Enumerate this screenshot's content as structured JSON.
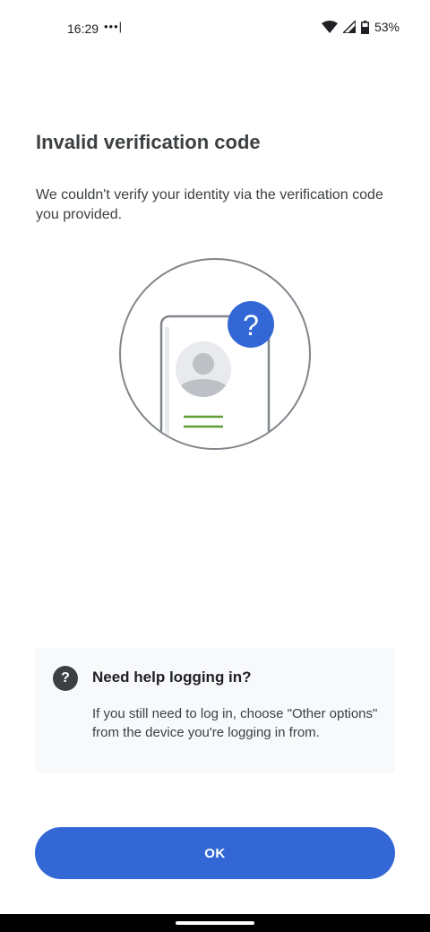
{
  "status_bar": {
    "time": "16:29",
    "dots": "•••|",
    "battery": "53%"
  },
  "page": {
    "title": "Invalid verification code",
    "subtitle": "We couldn't verify your identity via the verification code you provided."
  },
  "illustration": {
    "badge_glyph": "?",
    "icons": [
      "phone-icon",
      "avatar-icon",
      "question-badge-icon"
    ],
    "colors": {
      "badge": "#3367d6",
      "lines": "#5e9d37",
      "outline": "#80868b"
    }
  },
  "help": {
    "icon_glyph": "?",
    "title": "Need help logging in?",
    "body": "If you still need to log in, choose \"Other options\" from the device you're logging in from."
  },
  "actions": {
    "ok_label": "OK"
  },
  "colors": {
    "accent": "#3367d6",
    "text_dark": "#3c4043",
    "card_bg": "#f8f9fa"
  }
}
